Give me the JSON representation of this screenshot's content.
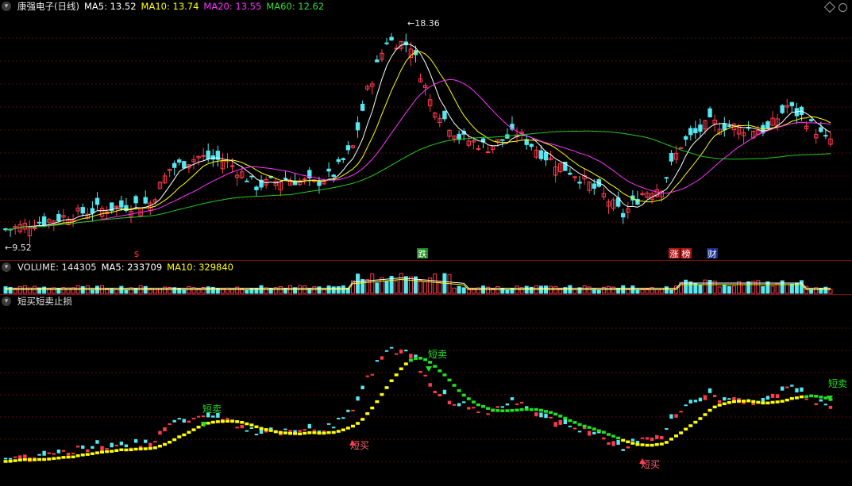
{
  "main": {
    "title": "康强电子(日线)",
    "ma": [
      {
        "label": "MA5: 13.52",
        "color": "#ffffff"
      },
      {
        "label": "MA10: 13.74",
        "color": "#ffff00"
      },
      {
        "label": "MA20: 13.55",
        "color": "#ff33ff"
      },
      {
        "label": "MA60: 12.62",
        "color": "#33dd33"
      }
    ],
    "high_label": "18.36",
    "low_label": "9.52",
    "markers": [
      {
        "text": "$",
        "color": "#ff3030"
      },
      {
        "text": "跌",
        "color": "#ffffff",
        "bg": "#1a8f1a"
      },
      {
        "text": "涨",
        "color": "#ffffff",
        "bg": "#b01818"
      },
      {
        "text": "榜",
        "color": "#ffffff",
        "bg": "#b01818"
      },
      {
        "text": "财",
        "color": "#ffffff",
        "bg": "#1a2f8f"
      }
    ]
  },
  "volume": {
    "label": "VOLUME: 144305",
    "ma5": "MA5: 233709",
    "ma10": "MA10: 329840"
  },
  "indicator": {
    "title": "短买短卖止损",
    "sell_label": "短卖",
    "buy_label": "短买"
  },
  "colors": {
    "up": "#ff3b4e",
    "down": "#55e8f0",
    "ma5": "#ffffff",
    "ma10": "#ffff00",
    "ma20": "#ff33ff",
    "ma60": "#22cc22",
    "stop_rise": "#ffff00",
    "stop_fall": "#22e022",
    "grid": "#5a0c0c",
    "volume_up": "#ff3b4e",
    "volume_down": "#55e8f0"
  },
  "icons": [
    "collapse-arrow-icon",
    "diamond-icon",
    "circle-icon"
  ]
}
